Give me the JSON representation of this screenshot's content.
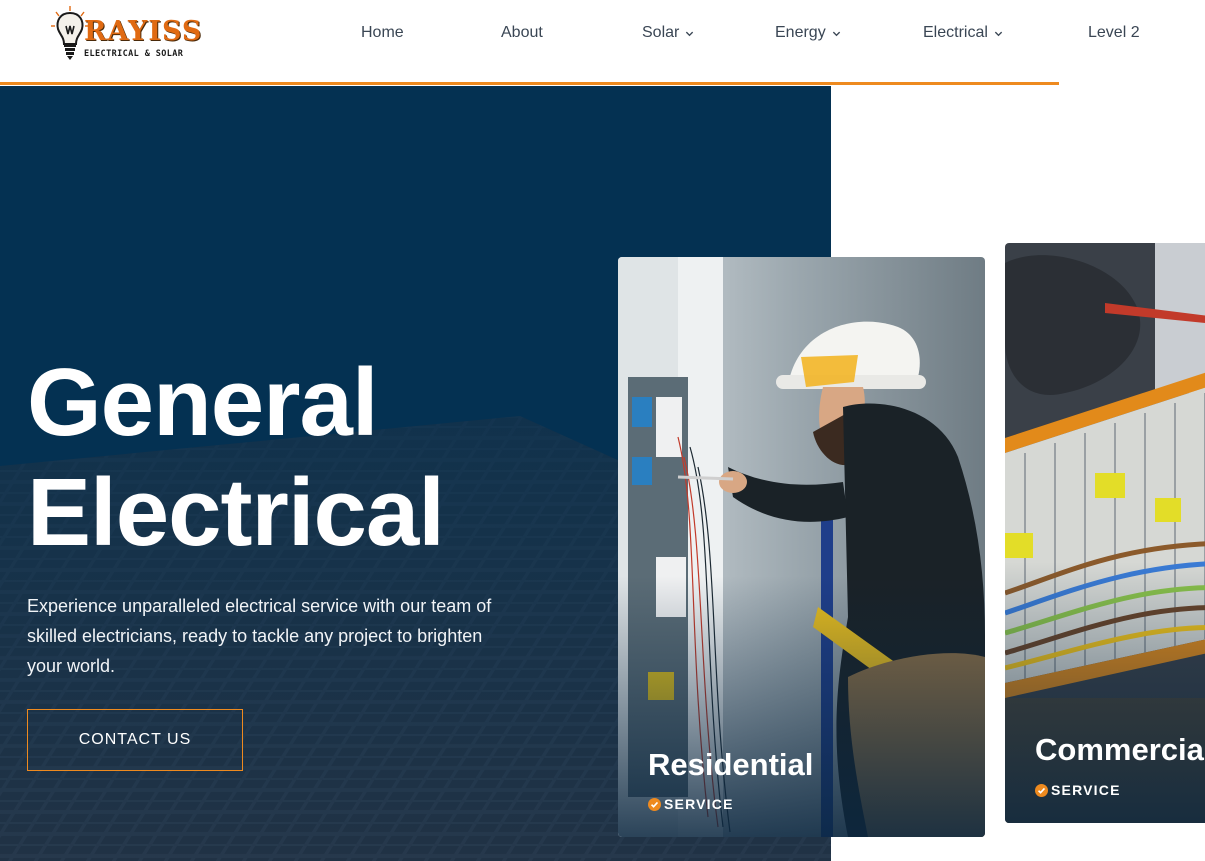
{
  "brand": {
    "name": "RAYISS",
    "tagline": "ELECTRICAL & SOLAR",
    "accent_color": "#ee8a1f",
    "navy_color": "#043152"
  },
  "nav": {
    "items": [
      {
        "label": "Home",
        "dropdown": false
      },
      {
        "label": "About",
        "dropdown": false
      },
      {
        "label": "Solar",
        "dropdown": true
      },
      {
        "label": "Energy",
        "dropdown": true
      },
      {
        "label": "Electrical",
        "dropdown": true
      },
      {
        "label": "Level 2",
        "dropdown": false
      }
    ]
  },
  "hero": {
    "title_line1": "General",
    "title_line2": "Electrical",
    "description": "Experience unparalleled electrical service with our team of skilled electricians, ready to tackle any project to brighten your world.",
    "cta_label": "CONTACT US",
    "background_image": "solar-panel-photo"
  },
  "services": [
    {
      "title": "Residential",
      "subtitle": "SERVICE",
      "icon": "check-circle-icon",
      "image": "electrician-at-panel-photo"
    },
    {
      "title": "Commercial",
      "subtitle": "SERVICE",
      "icon": "check-circle-icon",
      "image": "wiring-terminals-photo"
    }
  ]
}
